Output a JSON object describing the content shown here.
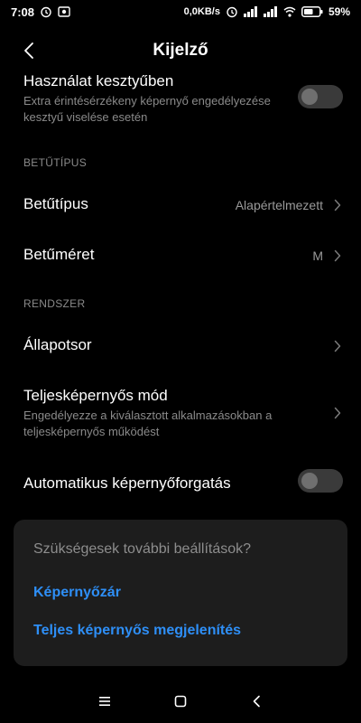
{
  "status_bar": {
    "time": "7:08",
    "speed": "0,0KB/s",
    "network": "4G",
    "battery": "59%"
  },
  "header": {
    "title": "Kijelző"
  },
  "rows": {
    "glove": {
      "title": "Használat kesztyűben",
      "subtitle": "Extra érintésérzékeny képernyő engedélyezése kesztyű viselése esetén",
      "toggle_on": false
    },
    "section_font": "BETŰTÍPUS",
    "font": {
      "title": "Betűtípus",
      "value": "Alapértelmezett"
    },
    "font_size": {
      "title": "Betűméret",
      "value": "M"
    },
    "section_system": "RENDSZER",
    "status_bar_item": {
      "title": "Állapotsor"
    },
    "fullscreen": {
      "title": "Teljesképernyős mód",
      "subtitle": "Engedélyezze a kiválasztott alkalmazásokban a teljesképernyős működést"
    },
    "auto_rotate": {
      "title": "Automatikus képernyőforgatás",
      "toggle_on": false
    }
  },
  "card": {
    "question": "Szükségesek további beállítások?",
    "link1": "Képernyőzár",
    "link2": "Teljes képernyős megjelenítés"
  },
  "colors": {
    "background": "#000000",
    "card": "#1d1d1d",
    "link": "#2e8ff7",
    "secondary_text": "#8a8a8a"
  },
  "icons": [
    "alarm-icon",
    "photo-icon",
    "signal-icon",
    "wifi-icon",
    "battery-icon",
    "back-chevron-icon",
    "chevron-right-icon",
    "menu-icon",
    "home-square-icon",
    "back-triangle-icon"
  ]
}
